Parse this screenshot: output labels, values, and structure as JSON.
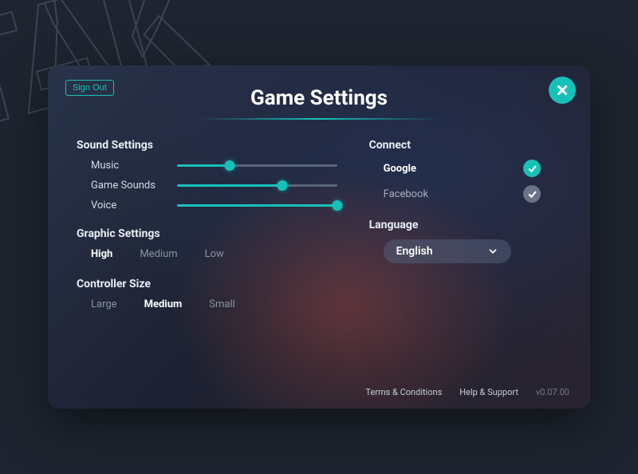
{
  "bg_decor": "TAK",
  "header": {
    "sign_out": "Sign Out",
    "title": "Game Settings"
  },
  "sound": {
    "heading": "Sound Settings",
    "sliders": [
      {
        "label": "Music",
        "value": 33
      },
      {
        "label": "Game Sounds",
        "value": 66
      },
      {
        "label": "Voice",
        "value": 100
      }
    ]
  },
  "graphic": {
    "heading": "Graphic Settings",
    "options": [
      "High",
      "Medium",
      "Low"
    ],
    "selected": "High"
  },
  "controller": {
    "heading": "Controller Size",
    "options": [
      "Large",
      "Medium",
      "Small"
    ],
    "selected": "Medium"
  },
  "connect": {
    "heading": "Connect",
    "providers": [
      {
        "name": "Google",
        "connected": true
      },
      {
        "name": "Facebook",
        "connected": false
      }
    ]
  },
  "language": {
    "heading": "Language",
    "selected": "English"
  },
  "footer": {
    "terms": "Terms & Conditions",
    "help": "Help & Support",
    "version": "v0.07.00"
  },
  "colors": {
    "accent": "#16c2b8",
    "bg": "#1e2530"
  }
}
